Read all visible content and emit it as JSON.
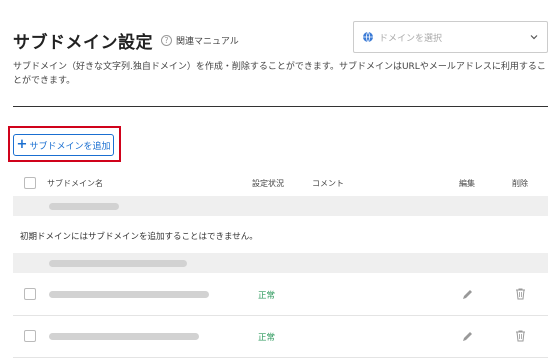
{
  "page": {
    "title": "サブドメイン設定",
    "help_link": "関連マニュアル",
    "description": "サブドメイン（好きな文字列.独自ドメイン）を作成・削除することができます。サブドメインはURLやメールアドレスに利用することができます。"
  },
  "domain_select": {
    "placeholder": "ドメインを選択"
  },
  "add_button": {
    "label": "サブドメインを追加"
  },
  "table": {
    "columns": {
      "name": "サブドメイン名",
      "status": "設定状況",
      "comment": "コメント",
      "edit": "編集",
      "delete": "削除"
    },
    "initial_domain_note": "初期ドメインにはサブドメインを追加することはできません。",
    "rows": [
      {
        "status": "正常"
      },
      {
        "status": "正常"
      }
    ]
  },
  "colors": {
    "accent": "#1a6fd1",
    "highlight": "#d0021b",
    "status_ok": "#2e9a5d"
  }
}
